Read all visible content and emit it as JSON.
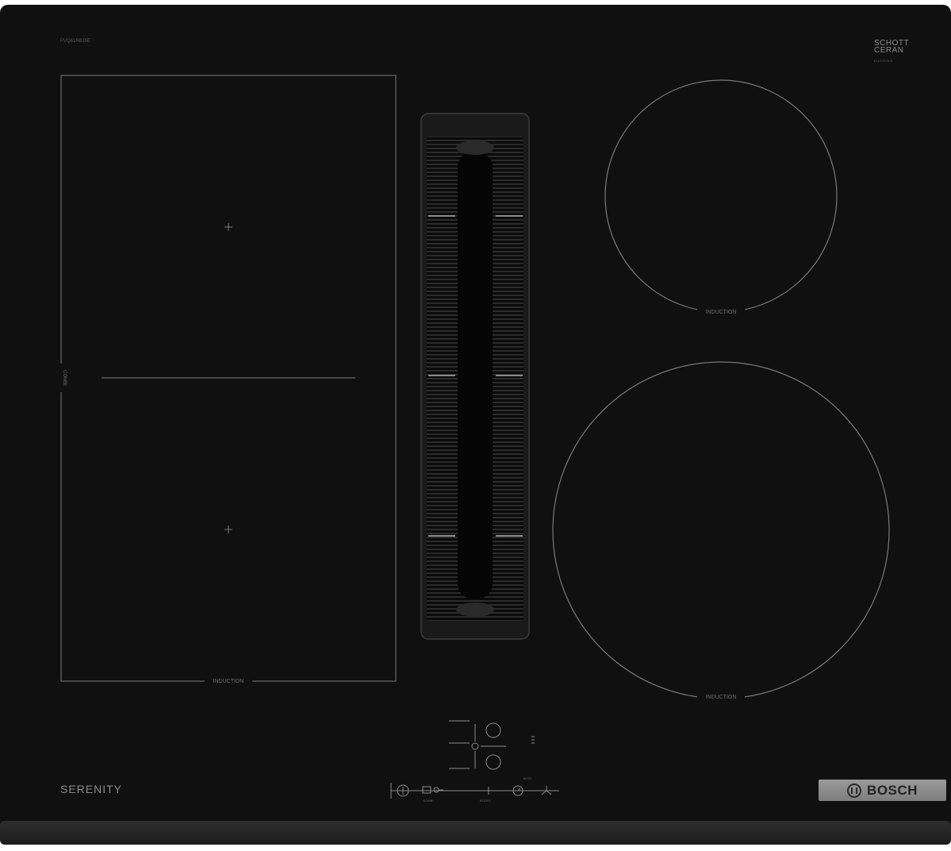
{
  "product": {
    "model_code": "PVQ61RBJ5E",
    "series_name": "SERENITY",
    "brand": "BOSCH",
    "glass_logo_line1": "SCHOTT",
    "glass_logo_line2": "CERAN",
    "glass_logo_sub": "EU/CH/NO"
  },
  "zones": {
    "combi_zone_label": "INDUCTION",
    "combi_side_label": "COMBI",
    "top_right_label": "INDUCTION",
    "bottom_right_label": "INDUCTION"
  },
  "controls": {
    "combi_label": "COMBI",
    "boost_label": "BOOST",
    "hood_indicator": "AUTO"
  },
  "colors": {
    "glass": "#0e0e0e",
    "zone_lines": "#6a6a6a",
    "frame_edge": "#3a3a3a",
    "brand_plate": "#8c8c8c"
  }
}
